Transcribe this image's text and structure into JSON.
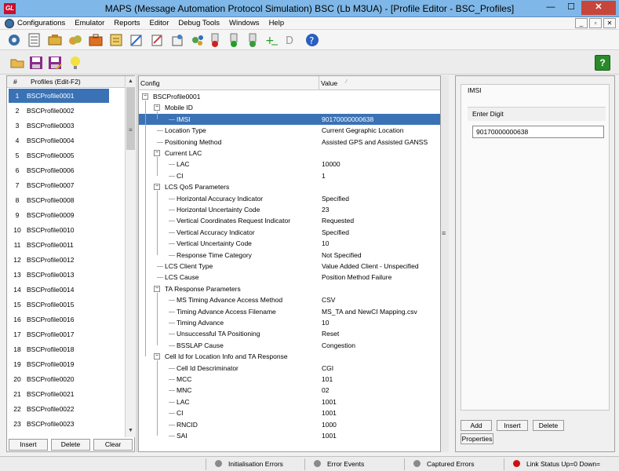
{
  "window": {
    "title": "MAPS (Message Automation Protocol Simulation) BSC (Lb  M3UA) - [Profile Editor - BSC_Profiles]",
    "app_icon_text": "GL",
    "minimize": "—",
    "maximize": "☐",
    "close": "✕"
  },
  "menubar": {
    "items": [
      "Configurations",
      "Emulator",
      "Reports",
      "Editor",
      "Debug Tools",
      "Windows",
      "Help"
    ],
    "mdi": [
      "_",
      "▫",
      "✕"
    ]
  },
  "toolbar1": {
    "icons": [
      "settings-gear-icon",
      "script-list-icon",
      "tools-icon",
      "call-gen-icon",
      "profile-briefcase-icon",
      "message-editor-icon",
      "bulk-edit-icon",
      "packet-icon",
      "record-red-icon",
      "record-green-icon",
      "phone-green-icon",
      "add-green-icon",
      "trace-icon",
      "help-blue-icon"
    ]
  },
  "toolbar2": {
    "icons": [
      "open-folder-icon",
      "save-icon",
      "save-as-icon",
      "lightbulb-icon"
    ],
    "help_label": "?"
  },
  "profiles": {
    "header_num": "#",
    "header_name": "Profiles (Edit-F2)",
    "items": [
      {
        "num": "1",
        "name": "BSCProfile0001"
      },
      {
        "num": "2",
        "name": "BSCProfile0002"
      },
      {
        "num": "3",
        "name": "BSCProfile0003"
      },
      {
        "num": "4",
        "name": "BSCProfile0004"
      },
      {
        "num": "5",
        "name": "BSCProfile0005"
      },
      {
        "num": "6",
        "name": "BSCProfile0006"
      },
      {
        "num": "7",
        "name": "BSCProfile0007"
      },
      {
        "num": "8",
        "name": "BSCProfile0008"
      },
      {
        "num": "9",
        "name": "BSCProfile0009"
      },
      {
        "num": "10",
        "name": "BSCProfile0010"
      },
      {
        "num": "11",
        "name": "BSCProfile0011"
      },
      {
        "num": "12",
        "name": "BSCProfile0012"
      },
      {
        "num": "13",
        "name": "BSCProfile0013"
      },
      {
        "num": "14",
        "name": "BSCProfile0014"
      },
      {
        "num": "15",
        "name": "BSCProfile0015"
      },
      {
        "num": "16",
        "name": "BSCProfile0016"
      },
      {
        "num": "17",
        "name": "BSCProfile0017"
      },
      {
        "num": "18",
        "name": "BSCProfile0018"
      },
      {
        "num": "19",
        "name": "BSCProfile0019"
      },
      {
        "num": "20",
        "name": "BSCProfile0020"
      },
      {
        "num": "21",
        "name": "BSCProfile0021"
      },
      {
        "num": "22",
        "name": "BSCProfile0022"
      },
      {
        "num": "23",
        "name": "BSCProfile0023"
      }
    ],
    "buttons": {
      "insert": "Insert",
      "delete": "Delete",
      "clear": "Clear"
    }
  },
  "config_tree": {
    "header_config": "Config",
    "header_value": "Value",
    "sort_glyph": "⁄",
    "rows": [
      {
        "label": "BSCProfile0001",
        "value": "",
        "level": 0,
        "expander": "−"
      },
      {
        "label": "Mobile ID",
        "value": "",
        "level": 1,
        "expander": "−"
      },
      {
        "label": "IMSI",
        "value": "90170000000638",
        "level": 2,
        "selected": true
      },
      {
        "label": "Location Type",
        "value": "Current Gegraphic Location",
        "level": 1
      },
      {
        "label": "Positioning Method",
        "value": "Assisted GPS and Assisted GANSS",
        "level": 1
      },
      {
        "label": "Current LAC",
        "value": "",
        "level": 1,
        "expander": "−"
      },
      {
        "label": "LAC",
        "value": "10000",
        "level": 2
      },
      {
        "label": "CI",
        "value": "1",
        "level": 2
      },
      {
        "label": "LCS QoS Parameters",
        "value": "",
        "level": 1,
        "expander": "−"
      },
      {
        "label": "Horizontal Accuracy Indicator",
        "value": "Specified",
        "level": 2
      },
      {
        "label": "Horizontal Uncertainty Code",
        "value": "23",
        "level": 2
      },
      {
        "label": "Vertical Coordinates Request Indicator",
        "value": "Requested",
        "level": 2
      },
      {
        "label": "Vertical Accuracy Indicator",
        "value": "Specified",
        "level": 2
      },
      {
        "label": "Vertical Uncertainty Code",
        "value": "10",
        "level": 2
      },
      {
        "label": "Response Time Category",
        "value": "Not Specified",
        "level": 2
      },
      {
        "label": "LCS Client Type",
        "value": "Value Added Client - Unspecified",
        "level": 1
      },
      {
        "label": "LCS Cause",
        "value": "Position Method Failure",
        "level": 1
      },
      {
        "label": "TA Response Parameters",
        "value": "",
        "level": 1,
        "expander": "−"
      },
      {
        "label": "MS Timing Advance Access Method",
        "value": "CSV",
        "level": 2
      },
      {
        "label": "Timing Advance Access Filename",
        "value": "MS_TA and NewCI Mapping.csv",
        "level": 2
      },
      {
        "label": "Timing Advance",
        "value": "10",
        "level": 2
      },
      {
        "label": "Unsuccessful TA Positioning",
        "value": "Reset",
        "level": 2
      },
      {
        "label": "BSSLAP Cause",
        "value": "Congestion",
        "level": 2
      },
      {
        "label": "Cell Id for Location Info and TA Response",
        "value": "",
        "level": 1,
        "expander": "−"
      },
      {
        "label": "Cell Id Descriminator",
        "value": "CGI",
        "level": 2
      },
      {
        "label": "MCC",
        "value": "101",
        "level": 2
      },
      {
        "label": "MNC",
        "value": "02",
        "level": 2
      },
      {
        "label": "LAC",
        "value": "1001",
        "level": 2
      },
      {
        "label": "CI",
        "value": "1001",
        "level": 2
      },
      {
        "label": "RNCID",
        "value": "1000",
        "level": 2
      },
      {
        "label": "SAI",
        "value": "1001",
        "level": 2
      }
    ]
  },
  "field_editor": {
    "title": "IMSI",
    "prompt": "Enter Digit",
    "value": "90170000000638",
    "buttons": {
      "add": "Add",
      "insert": "Insert",
      "delete": "Delete",
      "properties": "Properties"
    }
  },
  "statusbar": {
    "items": [
      {
        "label": "Initialisation Errors",
        "color": "#8a8a8a"
      },
      {
        "label": "Error Events",
        "color": "#8a8a8a"
      },
      {
        "label": "Captured Errors",
        "color": "#8a8a8a"
      },
      {
        "label": "Link Status Up=0 Down=",
        "color": "#d01010"
      }
    ]
  }
}
